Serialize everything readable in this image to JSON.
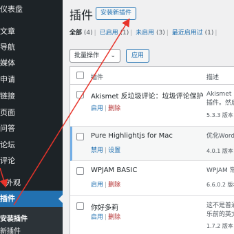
{
  "sidebar": {
    "items": [
      {
        "label": "仪表盘"
      },
      {
        "label": "文章"
      },
      {
        "label": "导航"
      },
      {
        "label": "媒体"
      },
      {
        "label": "申请"
      },
      {
        "label": "链接"
      },
      {
        "label": "页面"
      },
      {
        "label": "问答"
      },
      {
        "label": "论坛"
      },
      {
        "label": "评论"
      },
      {
        "label": "外观"
      },
      {
        "label": "插件"
      }
    ],
    "submenu": [
      {
        "label": "安装插件"
      },
      {
        "label": "新插件"
      }
    ]
  },
  "header": {
    "title": "插件",
    "add_new_label": "安装新插件"
  },
  "filters": [
    {
      "label": "全部",
      "count": "(4)",
      "current": true
    },
    {
      "label": "已启用",
      "count": "(1)"
    },
    {
      "label": "未启用",
      "count": "(3)"
    },
    {
      "label": "最近启用过",
      "count": "(1)"
    }
  ],
  "bulk": {
    "select_label": "批量操作",
    "apply_label": "应用"
  },
  "table": {
    "col_plugin": "插件",
    "col_desc": "描述",
    "rows": [
      {
        "name": "Akismet 反垃圾评论：垃圾评论保护",
        "actions": [
          {
            "label": "启用"
          },
          {
            "label": "删除"
          }
        ],
        "desc": [
          "Akismet 已",
          "插件。然后"
        ],
        "version": "5.3.3 版本"
      },
      {
        "name": "Pure Highlightjs for Mac",
        "actions": [
          {
            "label": "禁用"
          },
          {
            "label": "设置"
          }
        ],
        "desc": [
          "优化Wordi"
        ],
        "version": "4.0.1 版本"
      },
      {
        "name": "WPJAM BASIC",
        "actions": [
          {
            "label": "启用"
          },
          {
            "label": "删除"
          }
        ],
        "desc": [
          "WPJAM 常"
        ],
        "version": "6.6.0.2 版本"
      },
      {
        "name": "你好多莉",
        "actions": [
          {
            "label": "启用"
          },
          {
            "label": "删除"
          }
        ],
        "desc": [
          "这不是普通",
          "乐前的英文"
        ],
        "version": "1.7.2 版本"
      }
    ]
  },
  "colors": {
    "sidebar_bg": "#1d2327",
    "active_bg": "#2271b1",
    "link": "#2271b1",
    "delete": "#b32d2e",
    "annotation_arrow": "#e8332a"
  }
}
